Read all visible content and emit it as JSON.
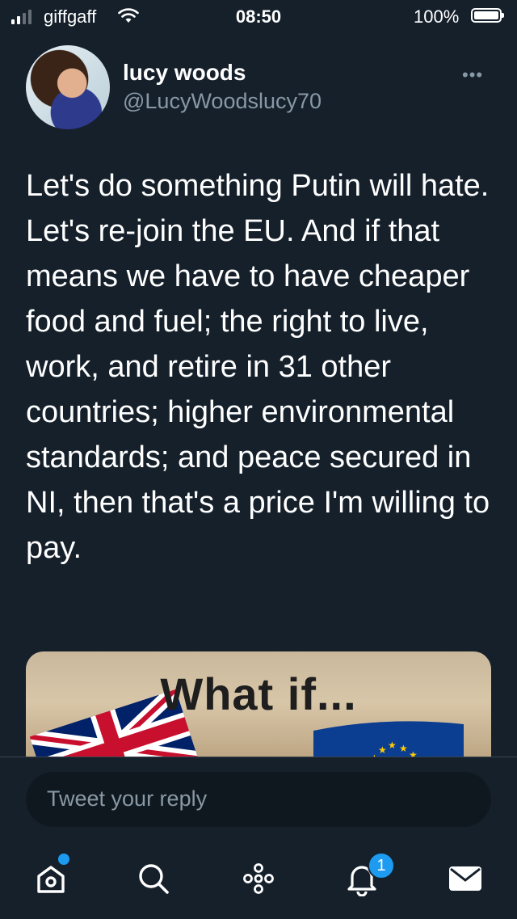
{
  "status_bar": {
    "carrier": "giffgaff",
    "time": "08:50",
    "battery": "100%"
  },
  "tweet": {
    "display_name": "lucy woods",
    "handle": "@LucyWoodslucy70",
    "more_label": "•••",
    "text": "Let's do something Putin will hate. Let's re-join the EU. And if that means we have to have cheaper food and fuel; the right to live, work, and retire in 31 other countries; higher environmental standards; and peace secured in NI, then that's a price I'm willing to pay.",
    "media": {
      "title": "What if..."
    }
  },
  "reply": {
    "placeholder": "Tweet your reply"
  },
  "tabbar": {
    "items": [
      {
        "name": "home",
        "icon": "home-icon"
      },
      {
        "name": "search",
        "icon": "search-icon"
      },
      {
        "name": "spaces",
        "icon": "spaces-icon"
      },
      {
        "name": "notifications",
        "icon": "bell-icon"
      },
      {
        "name": "messages",
        "icon": "mail-icon"
      }
    ],
    "notification_count": "1"
  },
  "colors": {
    "background": "#15202b",
    "accent": "#1d9bf0",
    "secondary_text": "#8899a6"
  }
}
